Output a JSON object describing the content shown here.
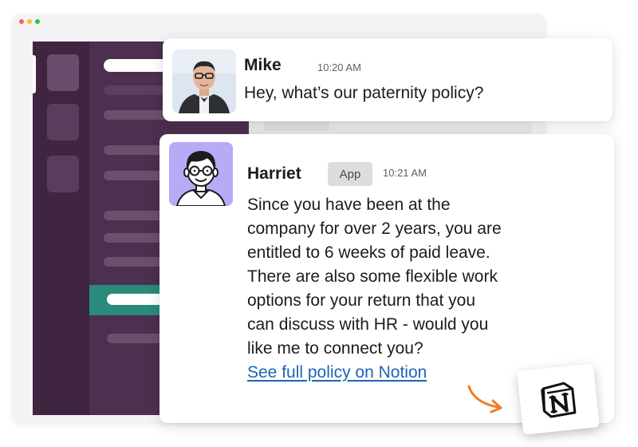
{
  "window": {
    "dot_colors": [
      "#ff5f57",
      "#febc2e",
      "#28c840"
    ]
  },
  "messages": [
    {
      "author": "Mike",
      "time": "10:20 AM",
      "text": "Hey, what’s our paternity policy?",
      "avatar": "mike-photo-avatar"
    },
    {
      "author": "Harriet",
      "badge": "App",
      "time": "10:21 AM",
      "text_lines": [
        "Since you have been at the",
        "company for over 2 years, you are",
        "entitled to 6 weeks of paid leave.",
        "There are also some flexible work",
        "options for your return that you",
        "can discuss with HR - would you",
        "like me to connect you?"
      ],
      "link": "See full policy on Notion",
      "avatar": "harriet-illustrated-avatar"
    }
  ],
  "colors": {
    "sidebar": "#4d2f4f",
    "rail": "#3f2540",
    "active_channel": "#2a8a7c",
    "link": "#1d64b5",
    "arrow": "#f07a24",
    "harriet_avatar_bg": "#b9aaf7"
  },
  "icons": {
    "notion": "notion-logo-icon",
    "arrow": "curved-arrow-icon"
  }
}
